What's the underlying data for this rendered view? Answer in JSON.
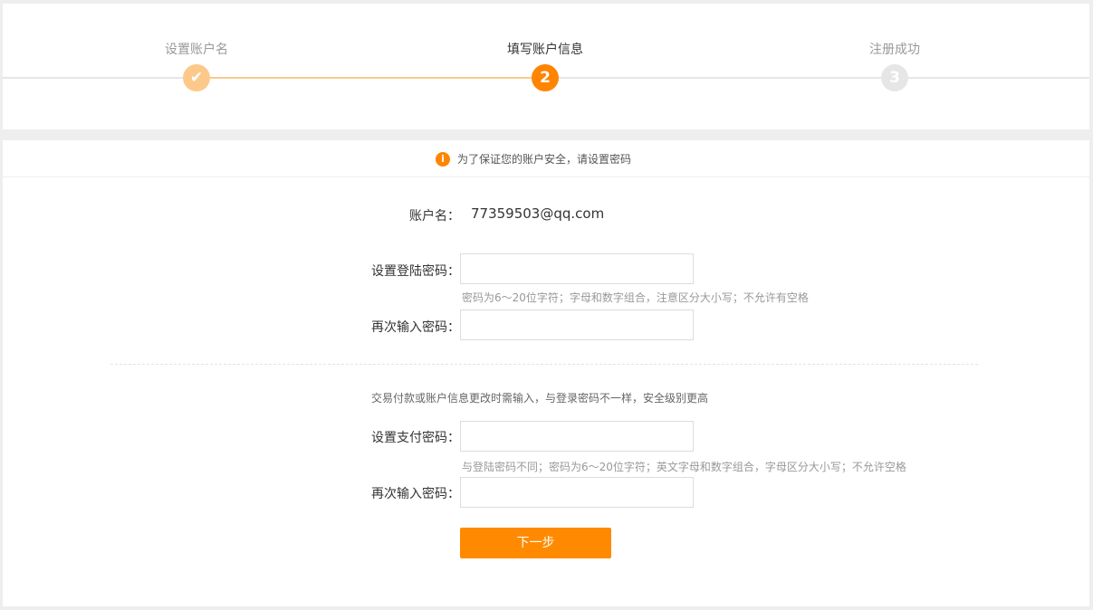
{
  "steps": [
    {
      "label": "设置账户名",
      "marker": "✔",
      "state": "done"
    },
    {
      "label": "填写账户信息",
      "marker": "2",
      "state": "current"
    },
    {
      "label": "注册成功",
      "marker": "3",
      "state": "pending"
    }
  ],
  "notice": {
    "icon": "info-icon",
    "icon_glyph": "i",
    "text": "为了保证您的账户安全，请设置密码"
  },
  "account": {
    "label": "账户名：",
    "value": "77359503@qq.com"
  },
  "login_password": {
    "label": "设置登陆密码：",
    "value": "",
    "hint": "密码为6～20位字符；字母和数字组合，注意区分大小写；不允许有空格",
    "confirm_label": "再次输入密码：",
    "confirm_value": ""
  },
  "pay_password": {
    "description": "交易付款或账户信息更改时需输入，与登录密码不一样，安全级别更高",
    "label": "设置支付密码：",
    "value": "",
    "hint": "与登陆密码不同；密码为6～20位字符；英文字母和数字组合，字母区分大小写；不允许空格",
    "confirm_label": "再次输入密码：",
    "confirm_value": ""
  },
  "next_button": "下一步",
  "colors": {
    "accent": "#ff8400",
    "done": "#fcc98a",
    "pending": "#e6e6e6"
  }
}
